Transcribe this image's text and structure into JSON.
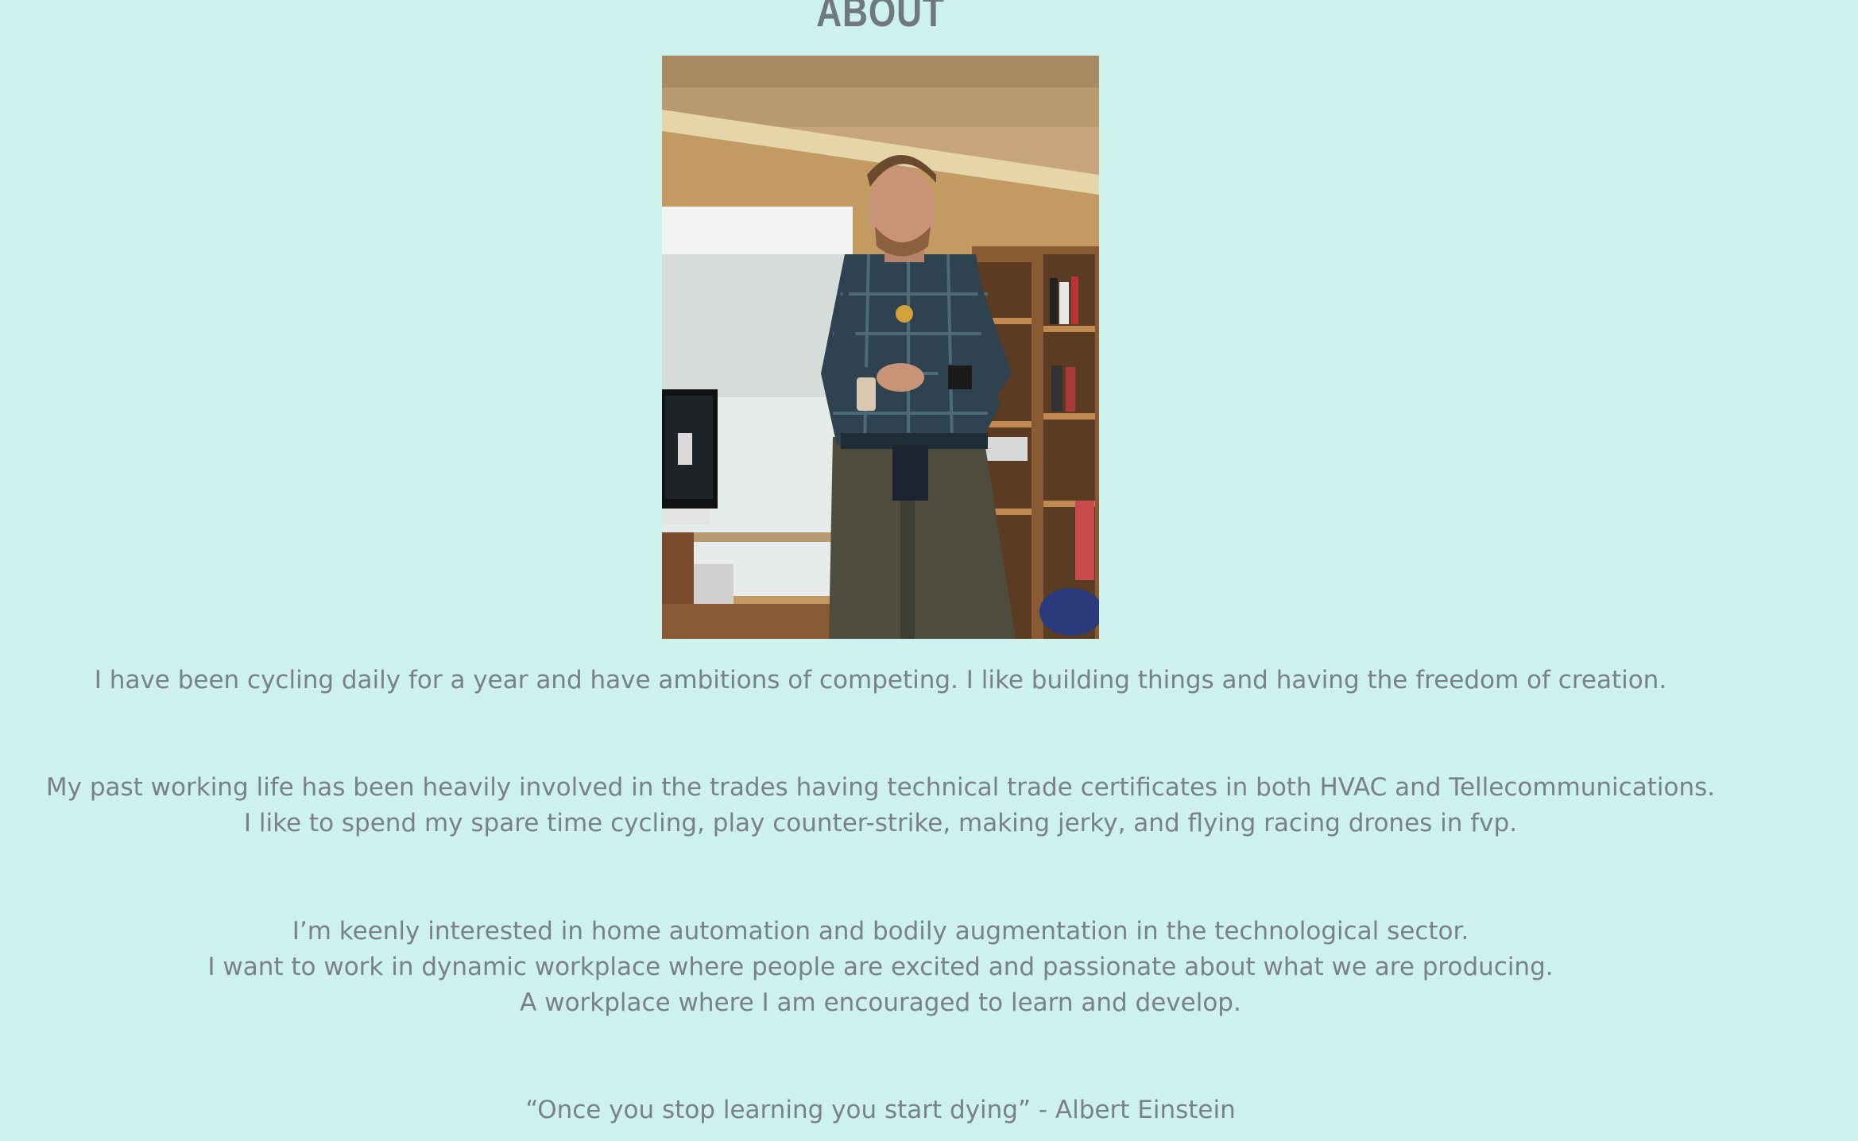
{
  "section": {
    "title": "ABOUT"
  },
  "photo": {
    "alt_icon": "person-photo"
  },
  "paragraphs": [
    {
      "lines": [
        "I have been cycling daily for a year and have ambitions of competing. I like building things and having the freedom of creation."
      ]
    },
    {
      "lines": [
        "My past working life has been heavily involved in the trades having technical trade certificates in both HVAC and Tellecommunications.",
        "I like to spend my spare time cycling, play counter-strike, making jerky, and flying racing drones in fvp."
      ]
    },
    {
      "lines": [
        "I’m keenly interested in home automation and bodily augmentation in the technological sector.",
        "I want to work in dynamic workplace where people are excited and passionate about what we are producing.",
        "A workplace where I am encouraged to learn and develop."
      ]
    },
    {
      "lines": [
        "“Once you stop learning you start dying” - Albert Einstein"
      ]
    }
  ],
  "colors": {
    "background": "#cdf1ec",
    "text": "#7a8087",
    "title": "#6f7781"
  }
}
